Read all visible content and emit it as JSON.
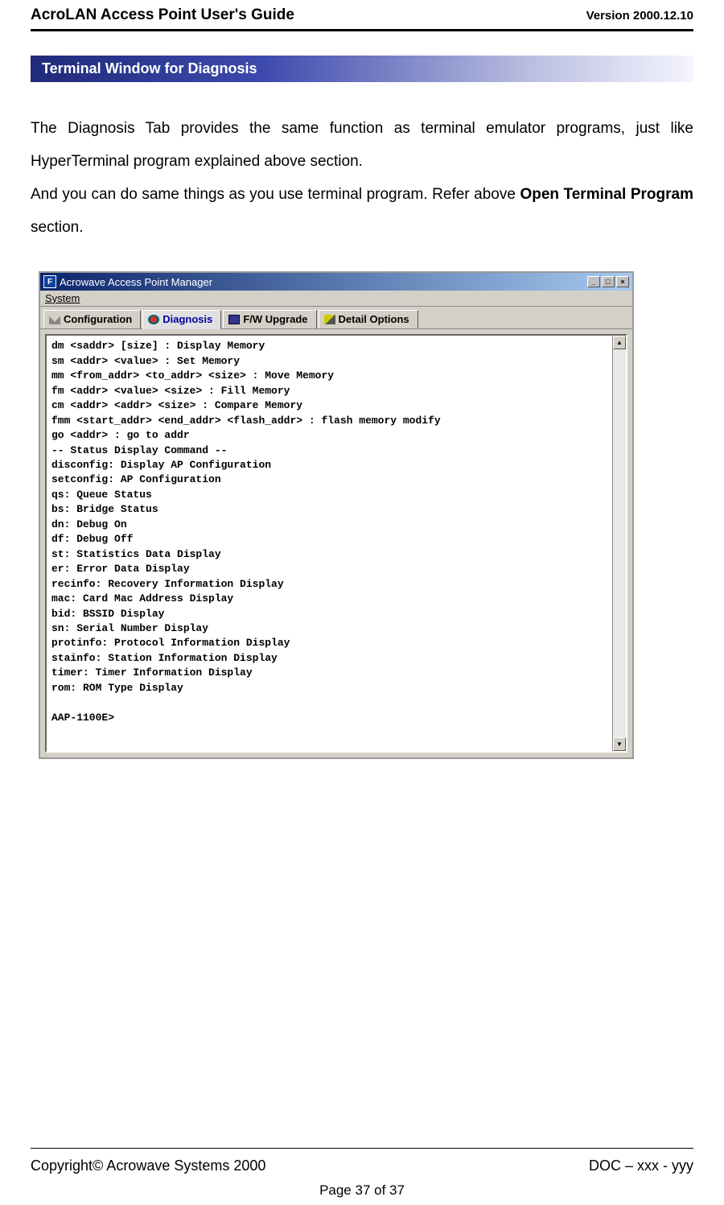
{
  "header": {
    "title": "AcroLAN Access Point User's Guide",
    "version": "Version 2000.12.10"
  },
  "section_bar": "Terminal Window for Diagnosis",
  "body": {
    "p1a": "The Diagnosis Tab provides the same function as terminal emulator programs, just like HyperTerminal program explained above section.",
    "p2a": "And you can do same things as you use terminal program. Refer above ",
    "p2b": "Open Terminal Program",
    "p2c": " section."
  },
  "window": {
    "title": "Acrowave Access Point Manager",
    "menu_system": "System",
    "tabs": {
      "config": "Configuration",
      "diag": "Diagnosis",
      "fw": "F/W Upgrade",
      "detail": "Detail Options"
    },
    "terminal_lines": "dm <saddr> [size] : Display Memory\nsm <addr> <value> : Set Memory\nmm <from_addr> <to_addr> <size> : Move Memory\nfm <addr> <value> <size> : Fill Memory\ncm <addr> <addr> <size> : Compare Memory\nfmm <start_addr> <end_addr> <flash_addr> : flash memory modify\ngo <addr> : go to addr\n-- Status Display Command --\ndisconfig: Display AP Configuration\nsetconfig: AP Configuration\nqs: Queue Status\nbs: Bridge Status\ndn: Debug On\ndf: Debug Off\nst: Statistics Data Display\ner: Error Data Display\nrecinfo: Recovery Information Display\nmac: Card Mac Address Display\nbid: BSSID Display\nsn: Serial Number Display\nprotinfo: Protocol Information Display\nstainfo: Station Information Display\ntimer: Timer Information Display\nrom: ROM Type Display\n\nAAP-1100E>"
  },
  "footer": {
    "copyright": "Copyright© Acrowave Systems 2000",
    "doc": "DOC – xxx - yyy",
    "page": "Page 37 of 37"
  }
}
